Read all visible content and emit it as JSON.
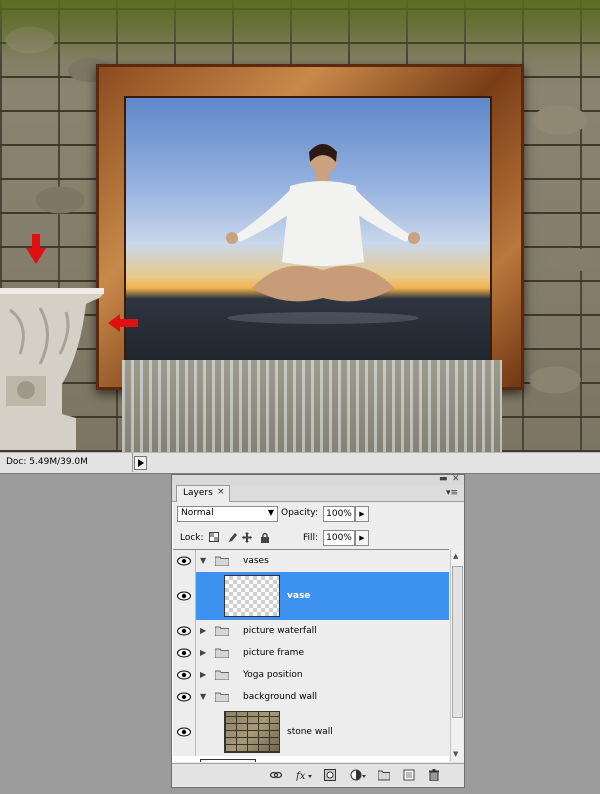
{
  "status": {
    "doc_info": "Doc: 5.49M/39.0M"
  },
  "panel": {
    "tab_label": "Layers",
    "tab_close": "×",
    "blend_mode": "Normal",
    "opacity_label": "Opacity:",
    "opacity_value": "100%",
    "lock_label": "Lock:",
    "fill_label": "Fill:",
    "fill_value": "100%",
    "layers": [
      {
        "name": "vases",
        "type": "group",
        "expanded": true
      },
      {
        "name": "vase",
        "type": "layer",
        "selected": true
      },
      {
        "name": "picture waterfall",
        "type": "group",
        "expanded": false
      },
      {
        "name": "picture frame",
        "type": "group",
        "expanded": false
      },
      {
        "name": "Yoga position",
        "type": "group",
        "expanded": false
      },
      {
        "name": "background wall",
        "type": "group",
        "expanded": true
      },
      {
        "name": "stone wall",
        "type": "layer"
      }
    ]
  },
  "colors": {
    "selection": "#3e92f0",
    "arrow_red": "#e01010",
    "panel_bg": "#ededed"
  },
  "icons": [
    "eye-icon",
    "folder-icon",
    "link-icon",
    "fx-icon",
    "mask-icon",
    "adjustment-icon",
    "new-group-icon",
    "new-layer-icon",
    "trash-icon",
    "lock-transparent-icon",
    "lock-brush-icon",
    "lock-move-icon",
    "lock-all-icon"
  ]
}
